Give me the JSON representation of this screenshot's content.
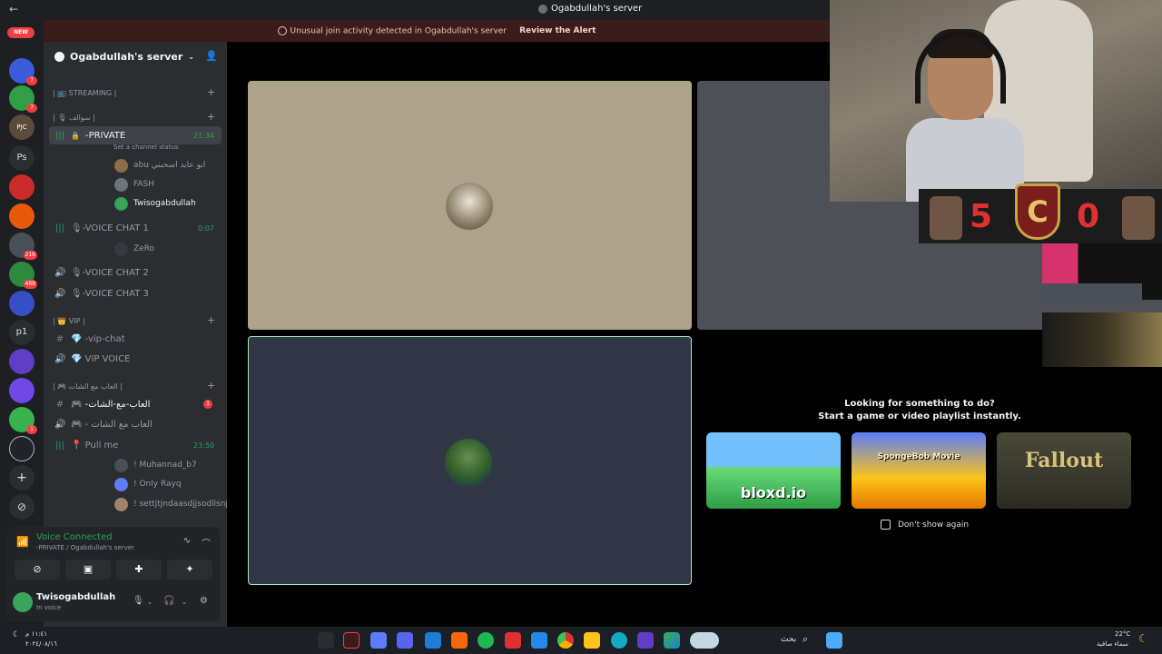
{
  "window": {
    "title": "Ogabdullah's server",
    "back_glyph": "←"
  },
  "alert": {
    "message": "Unusual join activity detected in Ogabdullah's server",
    "action": "Review the Alert"
  },
  "rail": {
    "new_label": "NEW",
    "badges": [
      "7",
      "7",
      "216",
      "488",
      "1"
    ],
    "text_items": [
      "Ps",
      "p1"
    ],
    "logo_text": "PJC",
    "add_glyph": "+",
    "explore_glyph": "⊘"
  },
  "sidebar": {
    "server_name": "Ogabdullah's server",
    "categories": {
      "streaming": "| 📺 STREAMING |",
      "talks": "| 🎙 سوالف |",
      "vip": "| 👑 VIP |",
      "games": "| 🎮 العاب مع الشات |"
    },
    "channels": {
      "private": {
        "name": "-PRIVATE",
        "time": "21:34",
        "status": "Set a channel status"
      },
      "voice1": {
        "name": "🎙-VOICE CHAT 1",
        "time": "0:07"
      },
      "voice2": {
        "name": "🎙-VOICE CHAT 2"
      },
      "voice3": {
        "name": "🎙-VOICE CHAT 3"
      },
      "vip_chat": {
        "name": "💎 -vip-chat"
      },
      "vip_voice": {
        "name": "💎 VIP VOICE"
      },
      "games_text": {
        "name": "🎮 -العاب-مع-الشات",
        "mentions": "1"
      },
      "games_voice": {
        "name": "🎮 - العاب مع الشات"
      },
      "pull_me": {
        "name": "📍 Pull me",
        "time": "23:50"
      }
    },
    "private_users": [
      "abu ابو عايد اسحبني",
      "FASH",
      "Twisogabdullah"
    ],
    "voice1_users": [
      "ZeRo"
    ],
    "pull_users": [
      "! Muhannad_b7",
      "! Only Rayq",
      "! settjtjndaasdjjsodllsnjflo..."
    ]
  },
  "voice_panel": {
    "status": "Voice Connected",
    "location": "-PRIVATE / Ogabdullah's server"
  },
  "user_panel": {
    "name": "Twisogabdullah",
    "status": "In voice"
  },
  "scoreboard": {
    "left": "5",
    "right": "0",
    "crest": "C"
  },
  "activity": {
    "heading_line1": "Looking for something to do?",
    "heading_line2": "Start a game or video playlist instantly.",
    "games": [
      "bloxd.io",
      "SpongeBob Movie",
      "Fallout"
    ],
    "dont_show": "Don't show again"
  },
  "taskbar": {
    "clock_time": "١١:٤١ م",
    "clock_date": "٢٠٢٤/٠٨/١٦",
    "search_label": "بحث",
    "weather_temp": "22°C",
    "weather_desc": "سماء صافية"
  },
  "colors": {
    "accent_green": "#23a55a",
    "danger": "#f23f43",
    "tile_tan": "#ada38a",
    "tile_slate": "#303645"
  }
}
